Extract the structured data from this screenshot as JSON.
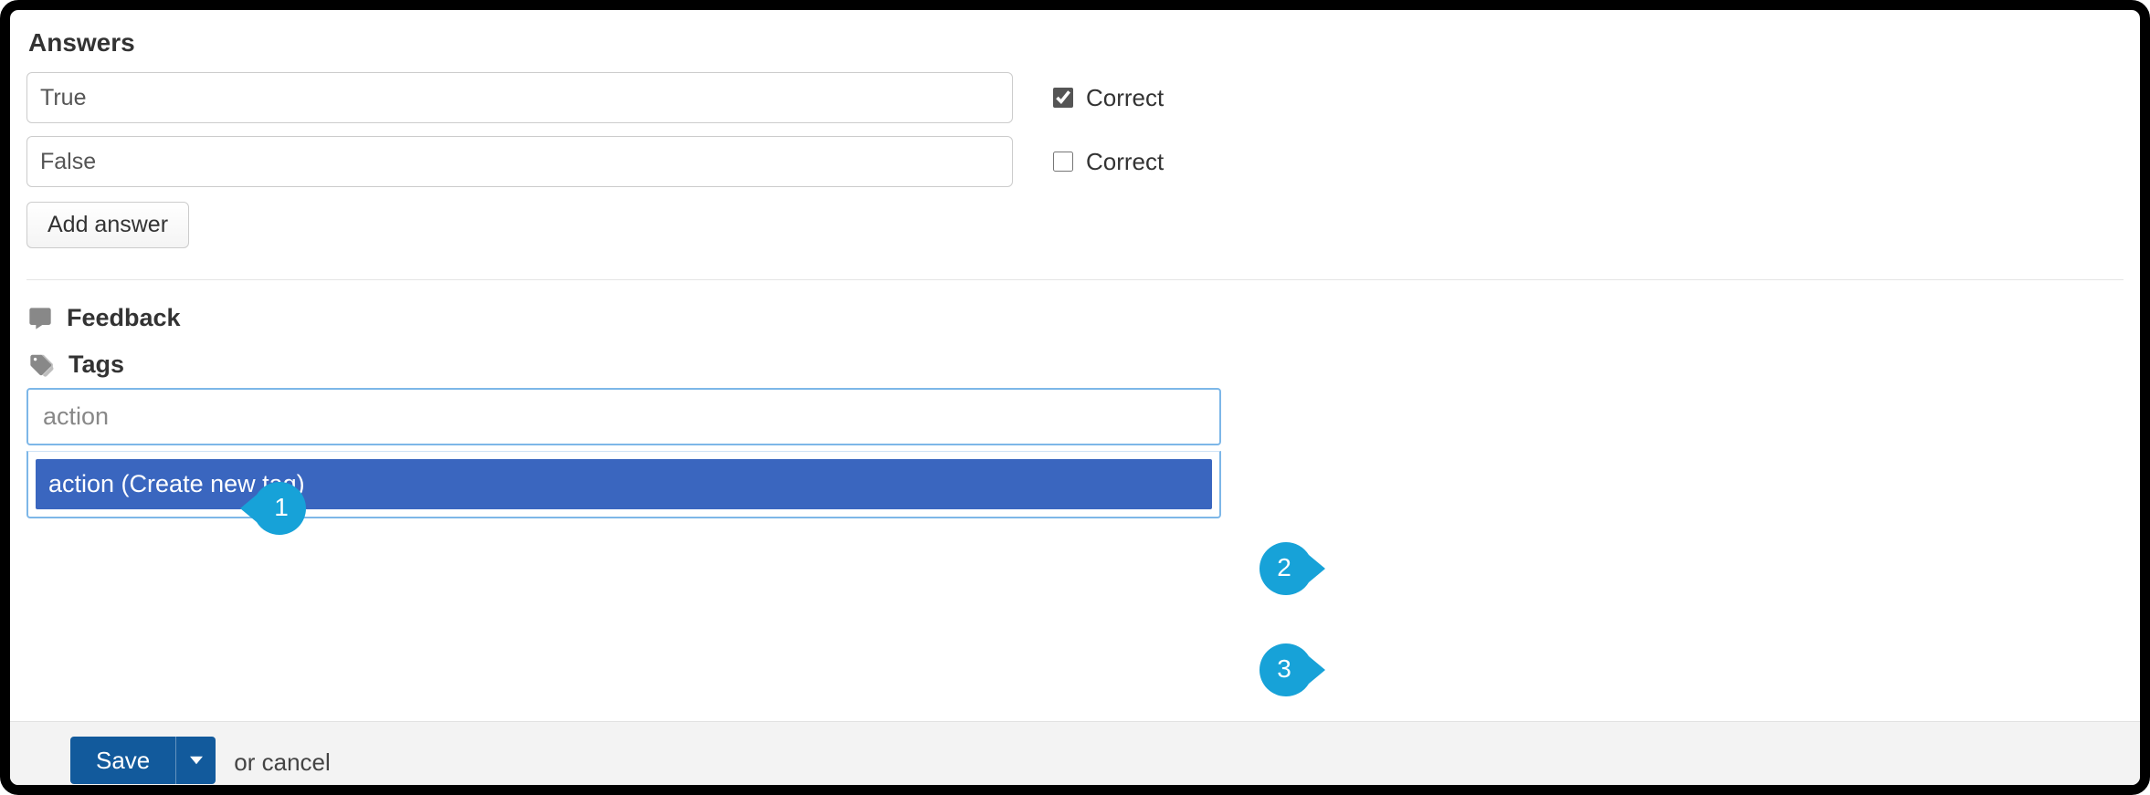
{
  "answers": {
    "title": "Answers",
    "items": [
      {
        "value": "True",
        "correct": true,
        "correct_label": "Correct"
      },
      {
        "value": "False",
        "correct": false,
        "correct_label": "Correct"
      }
    ],
    "add_button": "Add answer"
  },
  "feedback": {
    "label": "Feedback"
  },
  "tags": {
    "label": "Tags",
    "input_value": "action",
    "dropdown_option": "action (Create new tag)"
  },
  "actions": {
    "save": "Save",
    "or": "or ",
    "cancel": "cancel"
  },
  "annotations": {
    "a1": "1",
    "a2": "2",
    "a3": "3"
  }
}
